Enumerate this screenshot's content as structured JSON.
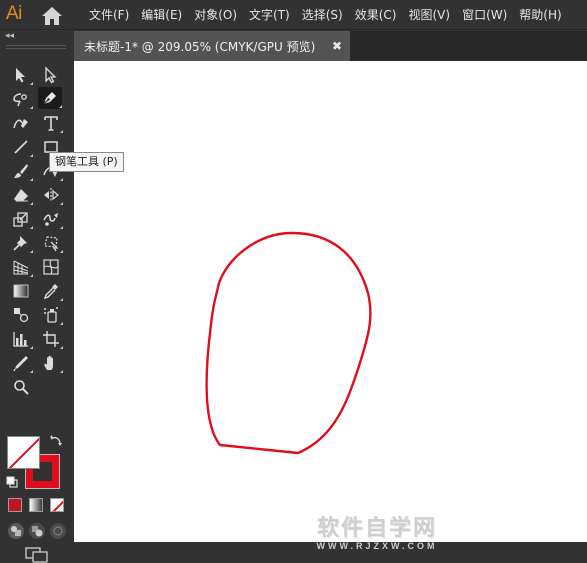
{
  "app": {
    "logo_text": "Ai"
  },
  "menu": {
    "items": [
      "文件(F)",
      "编辑(E)",
      "对象(O)",
      "文字(T)",
      "选择(S)",
      "效果(C)",
      "视图(V)",
      "窗口(W)",
      "帮助(H)"
    ]
  },
  "toolbar": {
    "collapse_glyph": "◂◂",
    "tooltip": "钢笔工具 (P)",
    "active_tool": "pen-tool",
    "tools": [
      "selection-tool",
      "direct-selection-tool",
      "magic-wand-tool",
      "pen-tool",
      "curvature-tool",
      "type-tool",
      "line-segment-tool",
      "rectangle-tool",
      "paintbrush-tool",
      "shaper-tool",
      "eraser-tool",
      "rotate-tool",
      "scale-tool",
      "warp-tool",
      "puppet-warp-tool",
      "free-transform-tool",
      "perspective-grid-tool",
      "mesh-tool",
      "gradient-tool",
      "eyedropper-tool",
      "blend-tool",
      "symbol-sprayer-tool",
      "column-graph-tool",
      "artboard-tool",
      "slice-tool",
      "hand-tool",
      "zoom-tool"
    ]
  },
  "colors": {
    "fill": "#ffffff",
    "stroke": "#e00e1d",
    "app_accent": "#E28A2B"
  },
  "document": {
    "tab_title": "未标题-1* @ 209.05% (CMYK/GPU 预览)",
    "close_glyph": "✖"
  },
  "watermark": {
    "main": "软件自学网",
    "sub": "WWW.RJZXW.COM"
  }
}
